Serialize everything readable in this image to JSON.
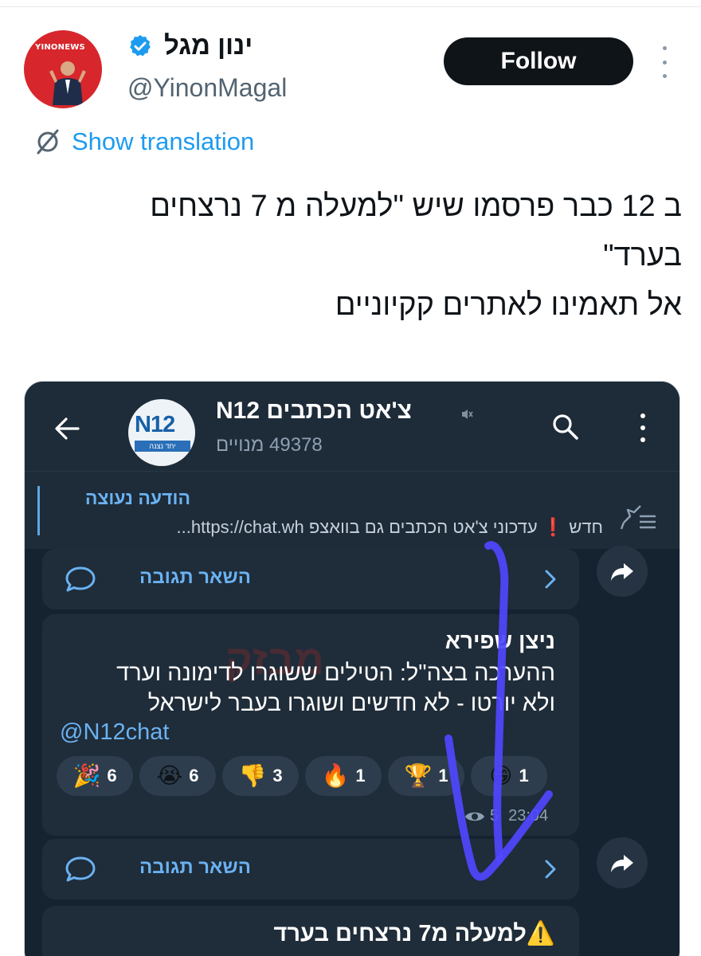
{
  "tweet": {
    "author": {
      "display_name": "ינון מגל",
      "handle": "@YinonMagal",
      "avatar_logo_text": "YINONEWS",
      "verified": true
    },
    "follow_label": "Follow",
    "translate_label": "Show translation",
    "text_lines": [
      "ב 12 כבר פרסמו שיש \"למעלה מ 7 נרצחים",
      "בערד\"",
      "אל תאמינו לאתרים קקיוניים"
    ]
  },
  "media": {
    "channel": {
      "title": "צ'אט הכתבים N12",
      "subscribers": "49378 מנויים",
      "avatar_text": "N12",
      "avatar_strip_text": "יחד נצנה"
    },
    "pinned": {
      "title": "הודעה נעוצה",
      "text": "חדש ❗ עדכוני צ'אט הכתבים גם בוואצפ  https://chat.wh..."
    },
    "reply_label": "השאר תגובה",
    "message": {
      "author": "ניצן שפירא",
      "lines": [
        "ההערכה בצה\"ל: הטילים ששוגרו לדימונה וערד",
        "ולא יורטו - לא חדשים ושוגרו בעבר לישראל"
      ],
      "link": "@N12chat",
      "watermark": "מבזק",
      "reactions": [
        {
          "emoji": "🎉",
          "count": "6"
        },
        {
          "emoji": "😭",
          "count": "6"
        },
        {
          "emoji": "👎",
          "count": "3"
        },
        {
          "emoji": "🔥",
          "count": "1"
        },
        {
          "emoji": "🏆",
          "count": "1"
        },
        {
          "emoji": "😁",
          "count": "1"
        }
      ],
      "views": "5",
      "time": "23:04"
    },
    "next_message": "⚠️למעלה מ7 נרצחים בערד"
  },
  "colors": {
    "follow_bg": "#0f1419",
    "link_blue": "#1d9bf0",
    "telegram_bg": "#152230",
    "annotation_arrow": "#4f46ff"
  }
}
